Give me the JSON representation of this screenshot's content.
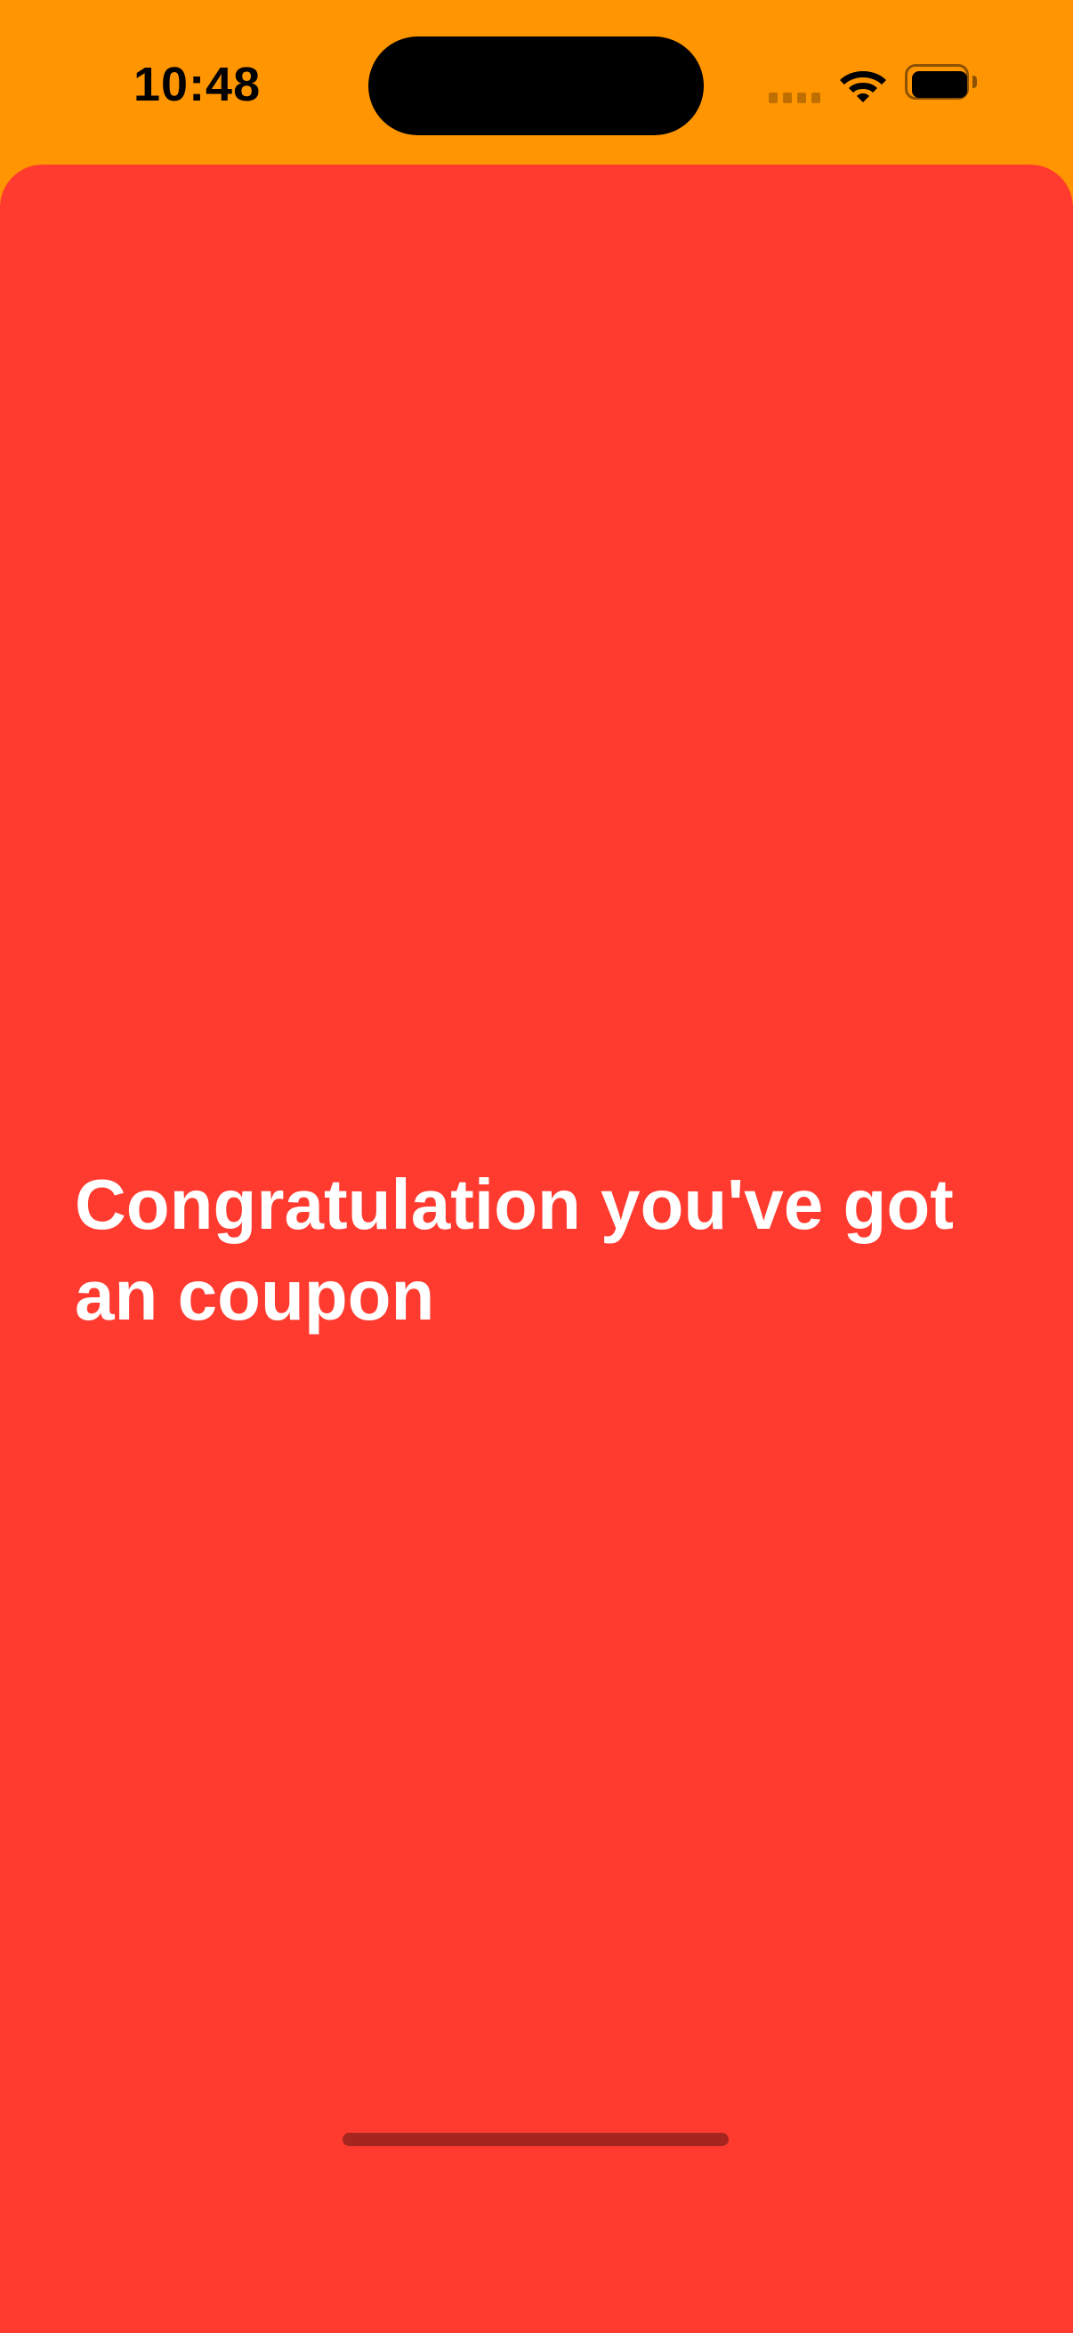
{
  "status_bar": {
    "time": "10:48",
    "icons": [
      "cellular-signal-icon",
      "wifi-icon",
      "battery-icon"
    ]
  },
  "main": {
    "message": "Congratulation you've got an coupon"
  },
  "colors": {
    "status_bar_background": "#FF9500",
    "sheet_background": "#FF3B30",
    "message_text": "#FFFFFF"
  }
}
